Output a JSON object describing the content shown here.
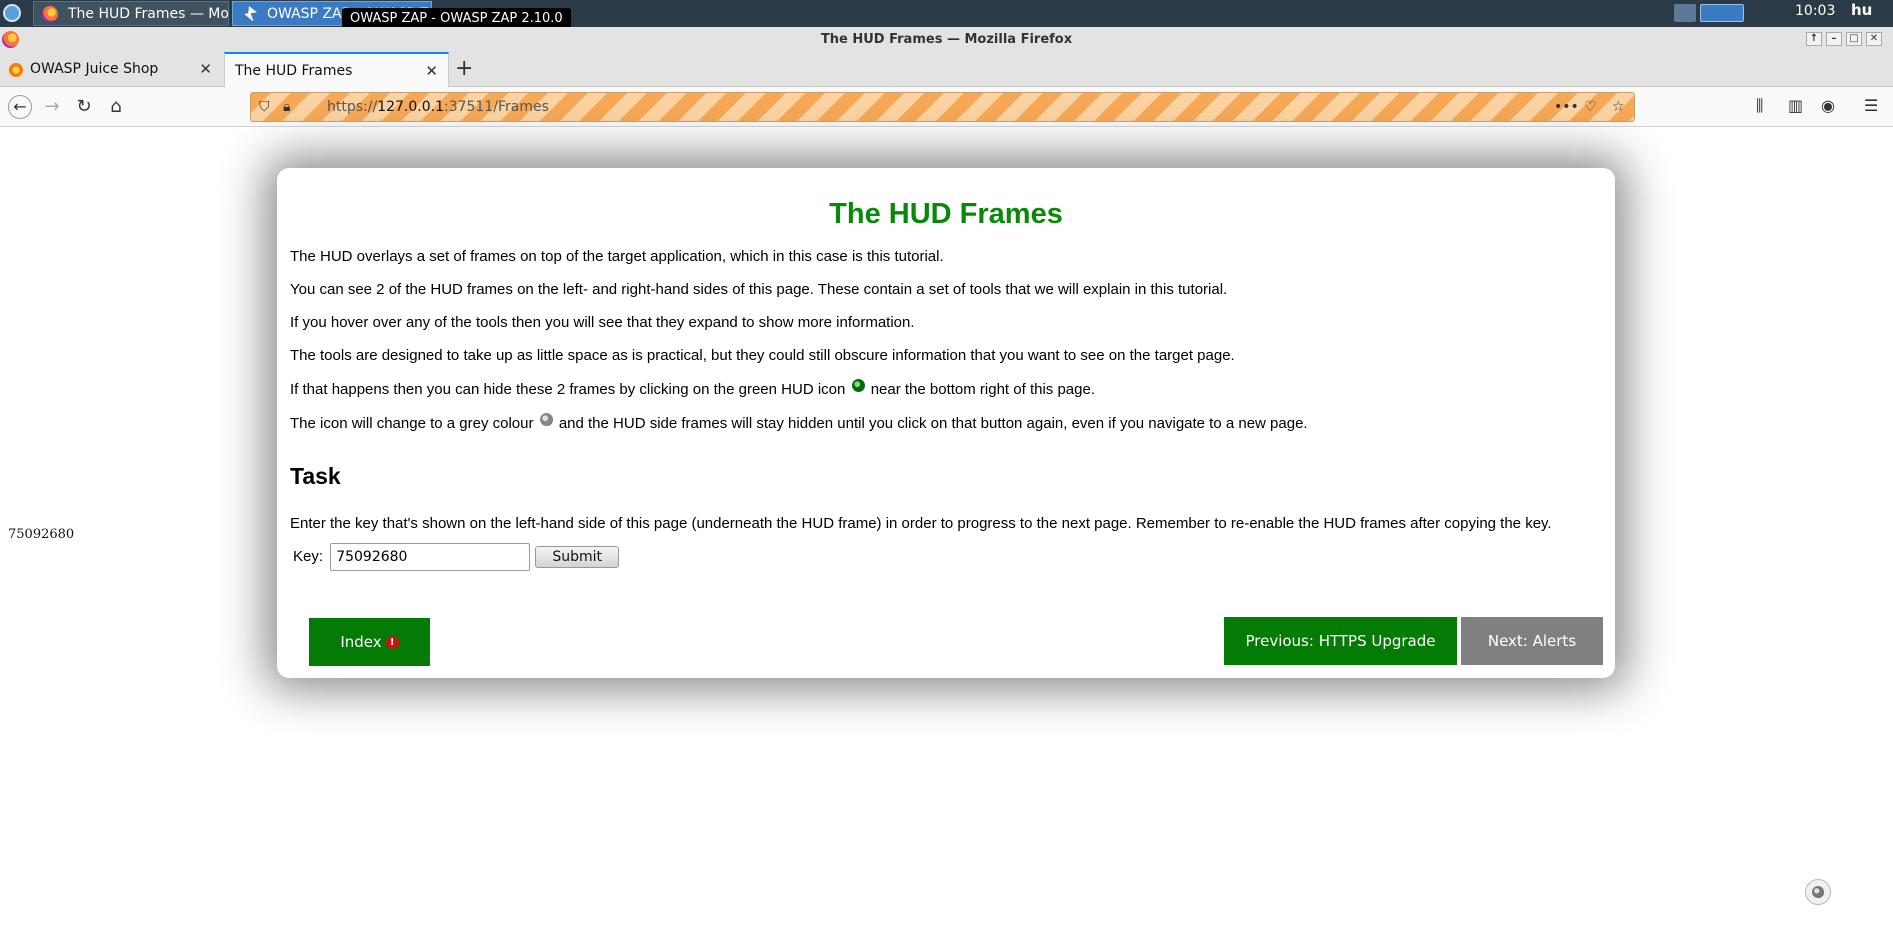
{
  "taskbar": {
    "tasks": [
      {
        "label": "The HUD Frames — Mo..."
      },
      {
        "label": "OWASP ZAP - OWASP Z..."
      }
    ],
    "tooltip": "OWASP ZAP - OWASP ZAP 2.10.0",
    "clock": "10:03",
    "lang": "hu"
  },
  "browser": {
    "window_title": "The HUD Frames — Mozilla Firefox",
    "tabs": [
      {
        "label": "OWASP Juice Shop",
        "close": "✕"
      },
      {
        "label": "The HUD Frames",
        "close": "✕"
      }
    ],
    "new_tab": "+",
    "url_scheme": "https://",
    "url_host": "127.0.0.1",
    "url_rest": ":37511/Frames"
  },
  "page": {
    "side_key": "75092680",
    "title": "The HUD Frames",
    "p1": "The HUD overlays a set of frames on top of the target application, which in this case is this tutorial.",
    "p2": "You can see 2 of the HUD frames on the left- and right-hand sides of this page. These contain a set of tools that we will explain in this tutorial.",
    "p3": "If you hover over any of the tools then you will see that they expand to show more information.",
    "p4": "The tools are designed to take up as little space as is practical, but they could still obscure information that you want to see on the target page.",
    "p5_before": "If that happens then you can hide these 2 frames by clicking on the green HUD icon",
    "p5_after": "near the bottom right of this page.",
    "p6_before": "The icon will change to a grey colour",
    "p6_after": "and the HUD side frames will stay hidden until you click on that button again, even if you navigate to a new page.",
    "task_heading": "Task",
    "task_text": "Enter the key that's shown on the left-hand side of this page (underneath the HUD frame) in order to progress to the next page. Remember to re-enable the HUD frames after copying the key.",
    "key_label": "Key:",
    "key_value": "75092680",
    "submit_label": "Submit",
    "btn_index": "Index",
    "index_badge": "!",
    "btn_prev": "Previous: HTTPS Upgrade",
    "btn_next": "Next: Alerts"
  }
}
